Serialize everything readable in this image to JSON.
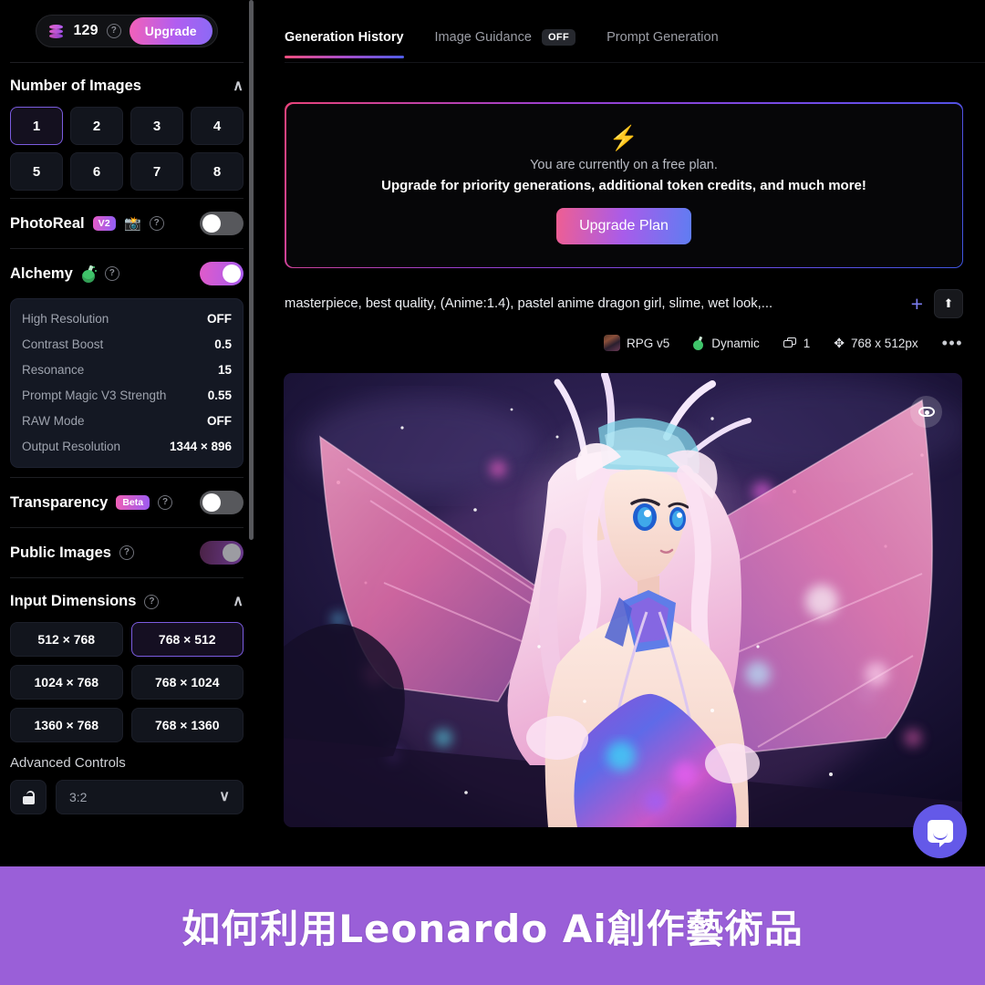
{
  "sidebar": {
    "credits": {
      "amount": "129",
      "help_icon": "help-circle-icon",
      "coin_icon": "coin-stack-icon",
      "upgrade_label": "Upgrade"
    },
    "number_of_images": {
      "title": "Number of Images",
      "collapse_icon": "chevron-up-icon",
      "options": [
        "1",
        "2",
        "3",
        "4",
        "5",
        "6",
        "7",
        "8"
      ],
      "selected": "1"
    },
    "photoreal": {
      "label": "PhotoReal",
      "badge": "V2",
      "camera_icon": "camera-flash-icon",
      "help_icon": "help-circle-icon",
      "state": "off"
    },
    "alchemy": {
      "label": "Alchemy",
      "potion_icon": "potion-flask-icon",
      "help_icon": "help-circle-icon",
      "state": "on",
      "settings": [
        {
          "key": "High Resolution",
          "value": "OFF"
        },
        {
          "key": "Contrast Boost",
          "value": "0.5"
        },
        {
          "key": "Resonance",
          "value": "15"
        },
        {
          "key": "Prompt Magic V3 Strength",
          "value": "0.55"
        },
        {
          "key": "RAW Mode",
          "value": "OFF"
        },
        {
          "key": "Output Resolution",
          "value": "1344 × 896"
        }
      ]
    },
    "transparency": {
      "label": "Transparency",
      "badge": "Beta",
      "help_icon": "help-circle-icon",
      "state": "off"
    },
    "public_images": {
      "label": "Public Images",
      "help_icon": "help-circle-icon",
      "state": "on"
    },
    "input_dimensions": {
      "title": "Input Dimensions",
      "help_icon": "help-circle-icon",
      "collapse_icon": "chevron-up-icon",
      "options": [
        "512 × 768",
        "768 × 512",
        "1024 × 768",
        "768 × 1024",
        "1360 × 768",
        "768 × 1360"
      ],
      "selected": "768 × 512"
    },
    "advanced_controls": {
      "label": "Advanced Controls",
      "lock_icon": "unlock-icon",
      "ratio_value": "3:2",
      "ratio_chevron": "chevron-down-icon"
    }
  },
  "main": {
    "tabs": [
      {
        "label": "Generation History",
        "active": true
      },
      {
        "label": "Image Guidance",
        "badge": "OFF",
        "active": false
      },
      {
        "label": "Prompt Generation",
        "active": false
      }
    ],
    "banner": {
      "bolt_icon": "lightning-bolt-icon",
      "line1": "You are currently on a free plan.",
      "line2": "Upgrade for priority generations, additional token credits, and much more!",
      "button_label": "Upgrade Plan"
    },
    "prompt": {
      "text": "masterpiece, best quality, (Anime:1.4), pastel anime dragon girl, slime, wet look,...",
      "add_icon": "plus-icon",
      "upload_icon": "arrow-up-icon"
    },
    "generation_meta": {
      "model_thumb_icon": "model-thumbnail-icon",
      "model": "RPG v5",
      "preset_icon": "potion-flask-icon",
      "preset": "Dynamic",
      "count_icon": "image-stack-icon",
      "count": "1",
      "size_icon": "resize-arrows-icon",
      "size": "768 x 512px",
      "more_icon": "more-options-icon"
    },
    "image": {
      "alt_name": "generated-dragon-girl-image",
      "eye_icon": "eye-icon"
    },
    "chat_widget": {
      "icon": "chat-bubble-icon",
      "color": "#6459e8"
    }
  },
  "caption": {
    "text": "如何利用Leonardo  Ai創作藝術品",
    "background": "#9a5fd8"
  },
  "colors": {
    "accent_purple": "#7b5ce0",
    "gradient_pink": "#ef4f7e",
    "gradient_blue": "#4f5de8",
    "panel_bg": "#141823",
    "button_bg": "#12151d"
  }
}
